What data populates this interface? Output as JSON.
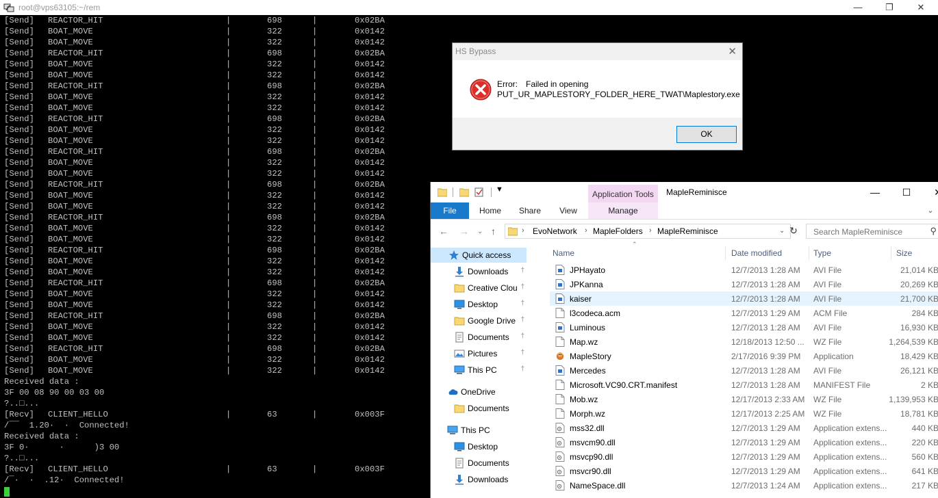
{
  "terminal": {
    "title": "root@vps63105:~/rem",
    "rows": [
      {
        "t": "[Send]",
        "n": "REACTOR_HIT",
        "s": "|",
        "l": "698",
        "p": "|",
        "h": "0x02BA"
      },
      {
        "t": "[Send]",
        "n": "BOAT_MOVE",
        "s": "|",
        "l": "322",
        "p": "|",
        "h": "0x0142"
      },
      {
        "t": "[Send]",
        "n": "BOAT_MOVE",
        "s": "|",
        "l": "322",
        "p": "|",
        "h": "0x0142"
      },
      {
        "t": "[Send]",
        "n": "REACTOR_HIT",
        "s": "|",
        "l": "698",
        "p": "|",
        "h": "0x02BA"
      },
      {
        "t": "[Send]",
        "n": "BOAT_MOVE",
        "s": "|",
        "l": "322",
        "p": "|",
        "h": "0x0142"
      },
      {
        "t": "[Send]",
        "n": "BOAT_MOVE",
        "s": "|",
        "l": "322",
        "p": "|",
        "h": "0x0142"
      },
      {
        "t": "[Send]",
        "n": "REACTOR_HIT",
        "s": "|",
        "l": "698",
        "p": "|",
        "h": "0x02BA"
      },
      {
        "t": "[Send]",
        "n": "BOAT_MOVE",
        "s": "|",
        "l": "322",
        "p": "|",
        "h": "0x0142"
      },
      {
        "t": "[Send]",
        "n": "BOAT_MOVE",
        "s": "|",
        "l": "322",
        "p": "|",
        "h": "0x0142"
      },
      {
        "t": "[Send]",
        "n": "REACTOR_HIT",
        "s": "|",
        "l": "698",
        "p": "|",
        "h": "0x02BA"
      },
      {
        "t": "[Send]",
        "n": "BOAT_MOVE",
        "s": "|",
        "l": "322",
        "p": "|",
        "h": "0x0142"
      },
      {
        "t": "[Send]",
        "n": "BOAT_MOVE",
        "s": "|",
        "l": "322",
        "p": "|",
        "h": "0x0142"
      },
      {
        "t": "[Send]",
        "n": "REACTOR_HIT",
        "s": "|",
        "l": "698",
        "p": "|",
        "h": "0x02BA"
      },
      {
        "t": "[Send]",
        "n": "BOAT_MOVE",
        "s": "|",
        "l": "322",
        "p": "|",
        "h": "0x0142"
      },
      {
        "t": "[Send]",
        "n": "BOAT_MOVE",
        "s": "|",
        "l": "322",
        "p": "|",
        "h": "0x0142"
      },
      {
        "t": "[Send]",
        "n": "REACTOR_HIT",
        "s": "|",
        "l": "698",
        "p": "|",
        "h": "0x02BA"
      },
      {
        "t": "[Send]",
        "n": "BOAT_MOVE",
        "s": "|",
        "l": "322",
        "p": "|",
        "h": "0x0142"
      },
      {
        "t": "[Send]",
        "n": "BOAT_MOVE",
        "s": "|",
        "l": "322",
        "p": "|",
        "h": "0x0142"
      },
      {
        "t": "[Send]",
        "n": "REACTOR_HIT",
        "s": "|",
        "l": "698",
        "p": "|",
        "h": "0x02BA"
      },
      {
        "t": "[Send]",
        "n": "BOAT_MOVE",
        "s": "|",
        "l": "322",
        "p": "|",
        "h": "0x0142"
      },
      {
        "t": "[Send]",
        "n": "BOAT_MOVE",
        "s": "|",
        "l": "322",
        "p": "|",
        "h": "0x0142"
      },
      {
        "t": "[Send]",
        "n": "REACTOR_HIT",
        "s": "|",
        "l": "698",
        "p": "|",
        "h": "0x02BA"
      },
      {
        "t": "[Send]",
        "n": "BOAT_MOVE",
        "s": "|",
        "l": "322",
        "p": "|",
        "h": "0x0142"
      },
      {
        "t": "[Send]",
        "n": "BOAT_MOVE",
        "s": "|",
        "l": "322",
        "p": "|",
        "h": "0x0142"
      },
      {
        "t": "[Send]",
        "n": "REACTOR_HIT",
        "s": "|",
        "l": "698",
        "p": "|",
        "h": "0x02BA"
      },
      {
        "t": "[Send]",
        "n": "BOAT_MOVE",
        "s": "|",
        "l": "322",
        "p": "|",
        "h": "0x0142"
      },
      {
        "t": "[Send]",
        "n": "BOAT_MOVE",
        "s": "|",
        "l": "322",
        "p": "|",
        "h": "0x0142"
      },
      {
        "t": "[Send]",
        "n": "REACTOR_HIT",
        "s": "|",
        "l": "698",
        "p": "|",
        "h": "0x02BA"
      },
      {
        "t": "[Send]",
        "n": "BOAT_MOVE",
        "s": "|",
        "l": "322",
        "p": "|",
        "h": "0x0142"
      },
      {
        "t": "[Send]",
        "n": "BOAT_MOVE",
        "s": "|",
        "l": "322",
        "p": "|",
        "h": "0x0142"
      },
      {
        "t": "[Send]",
        "n": "REACTOR_HIT",
        "s": "|",
        "l": "698",
        "p": "|",
        "h": "0x02BA"
      },
      {
        "t": "[Send]",
        "n": "BOAT_MOVE",
        "s": "|",
        "l": "322",
        "p": "|",
        "h": "0x0142"
      },
      {
        "t": "[Send]",
        "n": "BOAT_MOVE",
        "s": "|",
        "l": "322",
        "p": "|",
        "h": "0x0142"
      },
      {
        "x": "Received data :"
      },
      {
        "x": "3F 00 08 90 00 03 00"
      },
      {
        "x": "?..□..."
      },
      {
        "t": "[Recv]",
        "n": "CLIENT_HELLO",
        "s": "|",
        "l": "63",
        "p": "|",
        "h": "0x003F"
      },
      {
        "x": "/¯¯  1.20·  ·  Connected!"
      },
      {
        "x": "Received data :"
      },
      {
        "x": "3F 0·      ·      )3 00"
      },
      {
        "x": "?..□..."
      },
      {
        "t": "[Recv]",
        "n": "CLIENT_HELLO",
        "s": "|",
        "l": "63",
        "p": "|",
        "h": "0x003F"
      },
      {
        "x": "/¯·  ·  .12·  Connected!"
      }
    ]
  },
  "dialog": {
    "title": "HS Bypass",
    "error_label": "Error:",
    "error_text": "Failed in opening",
    "path_text": "PUT_UR_MAPLESTORY_FOLDER_HERE_TWAT\\Maplestory.exe",
    "ok_label": "OK"
  },
  "explorer": {
    "window_title": "MapleReminisce",
    "context_tab": "Application Tools",
    "tabs": [
      "File",
      "Home",
      "Share",
      "View",
      "Manage"
    ],
    "breadcrumb": [
      "EvoNetwork",
      "MapleFolders",
      "MapleReminisce"
    ],
    "search_placeholder": "Search MapleReminisce",
    "columns": [
      "Name",
      "Date modified",
      "Type",
      "Size"
    ],
    "nav": [
      {
        "label": "Quick access",
        "icon": "star",
        "pinned": false,
        "selected": true
      },
      {
        "label": "Downloads",
        "icon": "download",
        "pinned": true
      },
      {
        "label": "Creative Clou",
        "icon": "folder",
        "pinned": true
      },
      {
        "label": "Desktop",
        "icon": "desktop",
        "pinned": true
      },
      {
        "label": "Google Drive",
        "icon": "folder",
        "pinned": true
      },
      {
        "label": "Documents",
        "icon": "document",
        "pinned": true
      },
      {
        "label": "Pictures",
        "icon": "picture",
        "pinned": true
      },
      {
        "label": "This PC",
        "icon": "pc",
        "pinned": true
      },
      {
        "label": "OneDrive",
        "icon": "cloud",
        "pinned": false,
        "gap": true
      },
      {
        "label": "Documents",
        "icon": "folder",
        "pinned": false,
        "indent": true
      },
      {
        "label": "This PC",
        "icon": "pc",
        "pinned": false,
        "gap": true
      },
      {
        "label": "Desktop",
        "icon": "desktop",
        "pinned": false,
        "indent": true
      },
      {
        "label": "Documents",
        "icon": "document",
        "pinned": false,
        "indent": true
      },
      {
        "label": "Downloads",
        "icon": "download",
        "pinned": false,
        "indent": true
      }
    ],
    "files": [
      {
        "name": "JPHayato",
        "date": "12/7/2013 1:28 AM",
        "type": "AVI File",
        "size": "21,014 KB",
        "icon": "file"
      },
      {
        "name": "JPKanna",
        "date": "12/7/2013 1:28 AM",
        "type": "AVI File",
        "size": "20,269 KB",
        "icon": "file"
      },
      {
        "name": "kaiser",
        "date": "12/7/2013 1:28 AM",
        "type": "AVI File",
        "size": "21,700 KB",
        "icon": "file",
        "highlight": true
      },
      {
        "name": "l3codeca.acm",
        "date": "12/7/2013 1:29 AM",
        "type": "ACM File",
        "size": "284 KB",
        "icon": "blank"
      },
      {
        "name": "Luminous",
        "date": "12/7/2013 1:28 AM",
        "type": "AVI File",
        "size": "16,930 KB",
        "icon": "file"
      },
      {
        "name": "Map.wz",
        "date": "12/18/2013 12:50 ...",
        "type": "WZ File",
        "size": "1,264,539 KB",
        "icon": "blank"
      },
      {
        "name": "MapleStory",
        "date": "2/17/2016 9:39 PM",
        "type": "Application",
        "size": "18,429 KB",
        "icon": "app"
      },
      {
        "name": "Mercedes",
        "date": "12/7/2013 1:28 AM",
        "type": "AVI File",
        "size": "26,121 KB",
        "icon": "file"
      },
      {
        "name": "Microsoft.VC90.CRT.manifest",
        "date": "12/7/2013 1:28 AM",
        "type": "MANIFEST File",
        "size": "2 KB",
        "icon": "blank"
      },
      {
        "name": "Mob.wz",
        "date": "12/17/2013 2:33 AM",
        "type": "WZ File",
        "size": "1,139,953 KB",
        "icon": "blank"
      },
      {
        "name": "Morph.wz",
        "date": "12/17/2013 2:25 AM",
        "type": "WZ File",
        "size": "18,781 KB",
        "icon": "blank"
      },
      {
        "name": "mss32.dll",
        "date": "12/7/2013 1:29 AM",
        "type": "Application extens...",
        "size": "440 KB",
        "icon": "dll"
      },
      {
        "name": "msvcm90.dll",
        "date": "12/7/2013 1:29 AM",
        "type": "Application extens...",
        "size": "220 KB",
        "icon": "dll"
      },
      {
        "name": "msvcp90.dll",
        "date": "12/7/2013 1:29 AM",
        "type": "Application extens...",
        "size": "560 KB",
        "icon": "dll"
      },
      {
        "name": "msvcr90.dll",
        "date": "12/7/2013 1:29 AM",
        "type": "Application extens...",
        "size": "641 KB",
        "icon": "dll"
      },
      {
        "name": "NameSpace.dll",
        "date": "12/7/2013 1:24 AM",
        "type": "Application extens...",
        "size": "217 KB",
        "icon": "dll"
      }
    ]
  },
  "colors": {
    "terminal_bg": "#000000",
    "terminal_fg": "#c0c0c0",
    "cursor": "#3bd23b",
    "ribbon_file": "#1979ca",
    "app_tools": "#f3d7f3",
    "selection": "#cce8ff",
    "error_red": "#d9302a"
  }
}
